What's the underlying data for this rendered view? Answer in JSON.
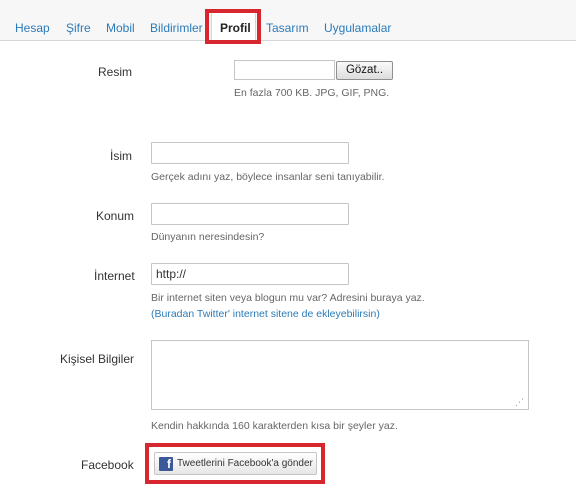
{
  "tabs": [
    {
      "label": "Hesap",
      "active": false
    },
    {
      "label": "Şifre",
      "active": false
    },
    {
      "label": "Mobil",
      "active": false
    },
    {
      "label": "Bildirimler",
      "active": false
    },
    {
      "label": "Profil",
      "active": true
    },
    {
      "label": "Tasarım",
      "active": false
    },
    {
      "label": "Uygulamalar",
      "active": false
    }
  ],
  "form": {
    "picture": {
      "label": "Resim",
      "button_label": "Gözat..",
      "help": "En fazla 700 KB. JPG, GIF, PNG."
    },
    "name": {
      "label": "İsim",
      "value": "",
      "help": "Gerçek adını yaz, böylece insanlar seni tanıyabilir."
    },
    "location": {
      "label": "Konum",
      "value": "",
      "help": "Dünyanın neresindesin?"
    },
    "website": {
      "label": "İnternet",
      "value": "http://",
      "help": "Bir internet siten veya blogun mu var? Adresini buraya yaz.",
      "help_link": "(Buradan Twitter' internet sitene de ekleyebilirsin)"
    },
    "bio": {
      "label": "Kişisel Bilgiler",
      "value": "",
      "help": "Kendin hakkında 160 karakterden kısa bir şeyler yaz."
    },
    "facebook": {
      "label": "Facebook",
      "button_label": "Tweetlerini Facebook'a gönder",
      "logo_letter": "f"
    }
  },
  "colors": {
    "link": "#2b7bb9",
    "highlight": "#d7262e",
    "facebook": "#3b5998"
  }
}
